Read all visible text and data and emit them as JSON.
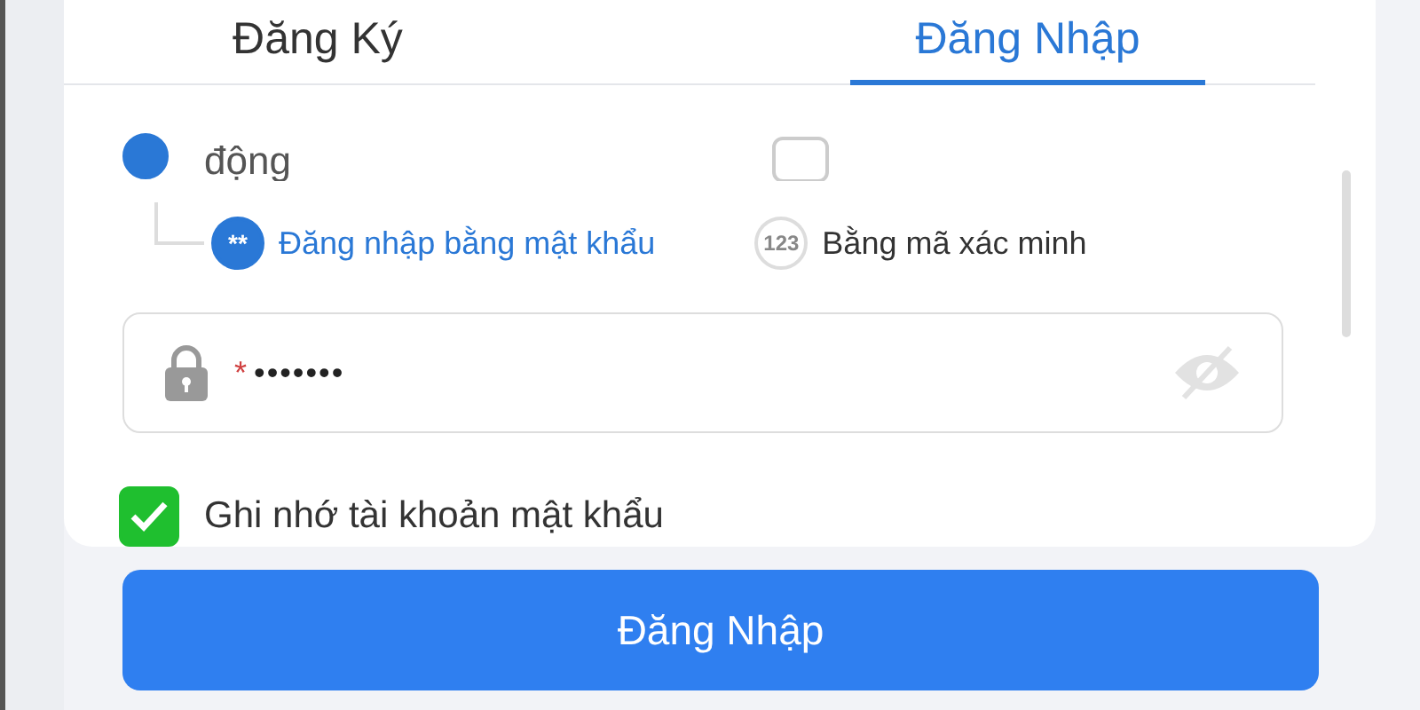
{
  "tabs": [
    {
      "label": "Đăng Ký",
      "selected": false
    },
    {
      "label": "Đăng Nhập",
      "selected": true
    }
  ],
  "account_types": [
    {
      "label": "động",
      "selected": true
    },
    {
      "selected": false
    }
  ],
  "login_methods": [
    {
      "badge": "**",
      "label": "Đăng nhập bằng mật khẩu",
      "selected": true
    },
    {
      "badge": "123",
      "label": "Bằng mã xác minh",
      "selected": false
    }
  ],
  "password": {
    "required_mark": "*",
    "value": "•••••••"
  },
  "remember": {
    "label": "Ghi nhớ tài khoản mật khẩu",
    "checked": true
  },
  "submit": "Đăng Nhập"
}
